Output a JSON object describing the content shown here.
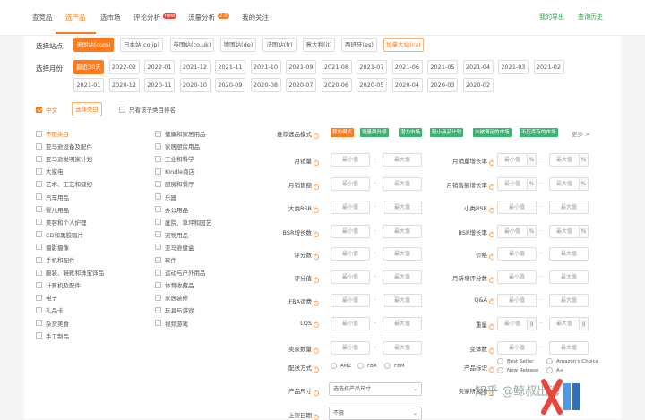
{
  "nav": {
    "tabs": [
      {
        "label": "查竞品"
      },
      {
        "label": "选产品"
      },
      {
        "label": "选市场"
      },
      {
        "label": "评论分析",
        "badge": "new"
      },
      {
        "label": "流量分析",
        "badge": "2.0"
      },
      {
        "label": "我的关注"
      }
    ],
    "my_export": "我的导出",
    "query_history": "查询历史"
  },
  "site": {
    "label": "选择站点:",
    "options": [
      "美国站(com)",
      "日本站(co.jp)",
      "英国站(co.uk)",
      "德国站(de)",
      "法国站(fr)",
      "意大利(it)",
      "西班牙(es)",
      "加拿大站(ca)"
    ]
  },
  "month": {
    "label": "选择月份:",
    "row1": [
      "最近30天",
      "2022-02",
      "2022-01",
      "2021-12",
      "2021-11",
      "2021-10",
      "2021-09",
      "2021-08",
      "2021-07",
      "2021-06",
      "2021-05",
      "2021-04",
      "2021-03",
      "2021-02"
    ],
    "row2": [
      "2021-01",
      "2020-12",
      "2020-11",
      "2020-10",
      "2020-09",
      "2020-08",
      "2020-07",
      "2020-06",
      "2020-05",
      "2020-04",
      "2020-03",
      "2020-02"
    ]
  },
  "lang": {
    "chinese": "中文",
    "select_category": "选择类目",
    "only_sub": "只看该子类目排名"
  },
  "categories_left": [
    "不限类目",
    "亚马逊设备及配件",
    "亚马逊发明家计划",
    "大家电",
    "艺术、工艺和缝纫",
    "汽车用品",
    "婴儿用品",
    "美容和个人护理",
    "CD和黑胶唱片",
    "摄影摄像",
    "手机和配件",
    "服装、鞋靴和珠宝饰品",
    "计算机及配件",
    "电子",
    "礼品卡",
    "杂货美食",
    "手工制品"
  ],
  "categories_right": [
    "健康和家居用品",
    "家居厨房用品",
    "工业和科学",
    "Kindle商店",
    "厨房和餐厅",
    "乐器",
    "办公用品",
    "庭院、草坪和园艺",
    "宠物用品",
    "亚马逊健盒",
    "软件",
    "运动与户外用品",
    "体育收藏品",
    "家居装修",
    "玩具与游戏",
    "视频游戏"
  ],
  "recommend": {
    "label": "推荐选品模式",
    "modes": [
      {
        "label": "我的模式",
        "color": "#ff7a1a"
      },
      {
        "label": "销量飙升榜",
        "color": "#3cb371"
      },
      {
        "label": "潜力市场",
        "color": "#3cb371"
      },
      {
        "label": "轻小商品计划",
        "color": "#3cb371"
      },
      {
        "label": "未被满足的市场",
        "color": "#3cb371"
      },
      {
        "label": "不压库存的市场",
        "color": "#3cb371"
      }
    ],
    "more": "更多 >"
  },
  "placeholders": {
    "min": "最小值",
    "max": "最大值"
  },
  "filters_left": [
    {
      "label": "月销量"
    },
    {
      "label": "月销售额"
    },
    {
      "label": "大类BSR"
    },
    {
      "label": "BSR增长数"
    },
    {
      "label": "评分数"
    },
    {
      "label": "评分值"
    },
    {
      "label": "FBA运费"
    },
    {
      "label": "LQS"
    },
    {
      "label": "卖家数量"
    }
  ],
  "filters_right": [
    {
      "label": "月销量增长率",
      "unit": "%"
    },
    {
      "label": "月销售额增长率",
      "unit": "%"
    },
    {
      "label": "小类BSR",
      "unit": ""
    },
    {
      "label": "BSR增长率",
      "unit": "%"
    },
    {
      "label": "价格",
      "unit": ""
    },
    {
      "label": "月新增评分数",
      "unit": ""
    },
    {
      "label": "Q&A",
      "unit": ""
    },
    {
      "label": "重量",
      "unit": "g"
    },
    {
      "label": "变体数",
      "unit": ""
    }
  ],
  "delivery": {
    "label": "配送方式",
    "options": [
      "AMZ",
      "FBA",
      "FBM"
    ]
  },
  "product_tag": {
    "label": "产品标识",
    "options": [
      "Best Seller",
      "Amazon's Choice",
      "New Release",
      "A+"
    ]
  },
  "size": {
    "label": "产品尺寸",
    "value": "选选择产品尺寸"
  },
  "seller_origin": {
    "label": "卖家所属地"
  },
  "launch": {
    "label": "上架日期",
    "value": "不限"
  },
  "watermark": "知乎 @鲸叔出海"
}
